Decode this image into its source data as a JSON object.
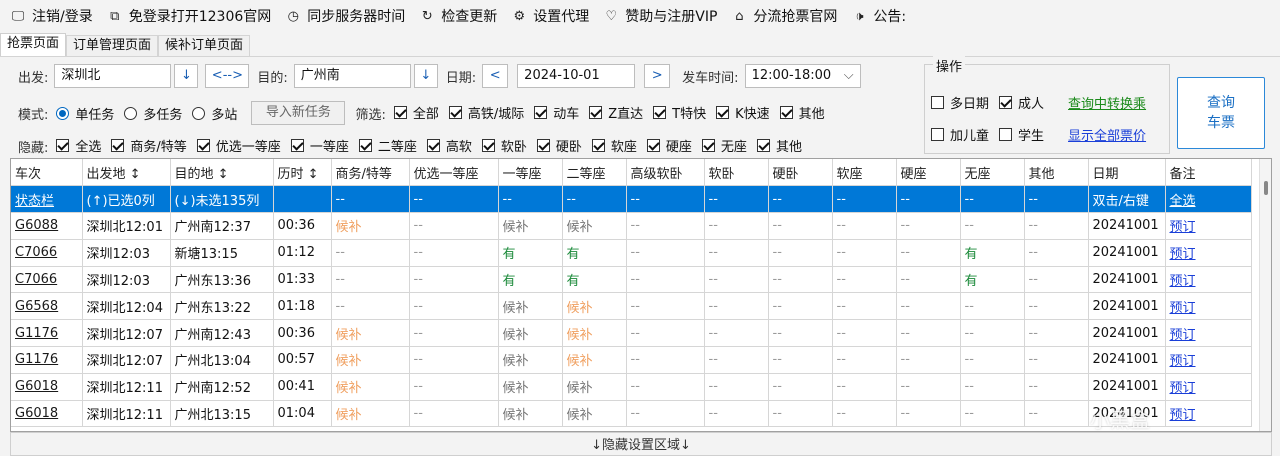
{
  "menu": [
    {
      "icon": "monitor-icon",
      "glyph": "🖵",
      "label": "注销/登录"
    },
    {
      "icon": "window-icon",
      "glyph": "⧉",
      "label": "免登录打开12306官网"
    },
    {
      "icon": "clock-icon",
      "glyph": "◷",
      "label": "同步服务器时间"
    },
    {
      "icon": "refresh-icon",
      "glyph": "↻",
      "label": "检查更新"
    },
    {
      "icon": "gear-icon",
      "glyph": "⚙",
      "label": "设置代理"
    },
    {
      "icon": "heart-icon",
      "glyph": "♡",
      "label": "赞助与注册VIP"
    },
    {
      "icon": "home-icon",
      "glyph": "⌂",
      "label": "分流抢票官网"
    },
    {
      "icon": "speaker-icon",
      "glyph": "🕩",
      "label": "公告:"
    }
  ],
  "tabs": [
    "抢票页面",
    "订单管理页面",
    "候补订单页面"
  ],
  "form": {
    "from_label": "出发:",
    "from_value": "深圳北",
    "arrow_down": "↓",
    "swap": "<-->",
    "to_label": "目的:",
    "to_value": "广州南",
    "date_label": "日期:",
    "prev": "<",
    "date_value": "2024-10-01",
    "next": ">",
    "time_label": "发车时间:",
    "time_value": "12:00-18:00",
    "dropdown": "⌵",
    "mode_label": "模式:",
    "mode_single": "单任务",
    "mode_multi": "多任务",
    "mode_station": "多站",
    "import_btn": "导入新任务",
    "filter_label": "筛选:",
    "filters": [
      "全部",
      "高铁/城际",
      "动车",
      "Z直达",
      "T特快",
      "K快速",
      "其他"
    ],
    "hide_label": "隐藏:",
    "hides": [
      "全选",
      "商务/特等",
      "优选一等座",
      "一等座",
      "二等座",
      "高软",
      "软卧",
      "硬卧",
      "软座",
      "硬座",
      "无座",
      "其他"
    ]
  },
  "ops": {
    "legend": "操作",
    "multi_date": "多日期",
    "adult": "成人",
    "child": "加儿童",
    "student": "学生",
    "transfer_link": "查询中转换乘",
    "all_price_link": "显示全部票价",
    "query_btn_line1": "查询",
    "query_btn_line2": "车票"
  },
  "table": {
    "headers": [
      "车次",
      "出发地 ↕",
      "目的地 ↕",
      "历时 ↕",
      "商务/特等",
      "优选一等座",
      "一等座",
      "二等座",
      "高级软卧",
      "软卧",
      "硬卧",
      "软座",
      "硬座",
      "无座",
      "其他",
      "日期",
      "备注"
    ],
    "status_row": [
      "状态栏",
      "(↑)已选0列",
      "(↓)未选135列",
      "",
      "--",
      "--",
      "--",
      "--",
      "--",
      "--",
      "--",
      "--",
      "--",
      "--",
      "--",
      "双击/右键",
      "全选"
    ],
    "rows": [
      [
        "G6088",
        "深圳北12:01",
        "广州南12:37",
        "00:36",
        "候补",
        "--",
        "候补",
        "候补",
        "--",
        "--",
        "--",
        "--",
        "--",
        "--",
        "--",
        "20241001",
        "预订"
      ],
      [
        "C7066",
        "深圳12:03",
        "新塘13:15",
        "01:12",
        "--",
        "--",
        "有",
        "有",
        "--",
        "--",
        "--",
        "--",
        "--",
        "有",
        "--",
        "20241001",
        "预订"
      ],
      [
        "C7066",
        "深圳12:03",
        "广州东13:36",
        "01:33",
        "--",
        "--",
        "有",
        "有",
        "--",
        "--",
        "--",
        "--",
        "--",
        "有",
        "--",
        "20241001",
        "预订"
      ],
      [
        "G6568",
        "深圳北12:04",
        "广州东13:22",
        "01:18",
        "--",
        "--",
        "候补",
        "候补",
        "--",
        "--",
        "--",
        "--",
        "--",
        "--",
        "--",
        "20241001",
        "预订"
      ],
      [
        "G1176",
        "深圳北12:07",
        "广州南12:43",
        "00:36",
        "候补",
        "--",
        "候补",
        "候补",
        "--",
        "--",
        "--",
        "--",
        "--",
        "--",
        "--",
        "20241001",
        "预订"
      ],
      [
        "G1176",
        "深圳北12:07",
        "广州北13:04",
        "00:57",
        "候补",
        "--",
        "候补",
        "候补",
        "--",
        "--",
        "--",
        "--",
        "--",
        "--",
        "--",
        "20241001",
        "预订"
      ],
      [
        "G6018",
        "深圳北12:11",
        "广州南12:52",
        "00:41",
        "候补",
        "--",
        "候补",
        "候补",
        "--",
        "--",
        "--",
        "--",
        "--",
        "--",
        "--",
        "20241001",
        "预订"
      ],
      [
        "G6018",
        "深圳北12:11",
        "广州北13:15",
        "01:04",
        "候补",
        "--",
        "候补",
        "候补",
        "--",
        "--",
        "--",
        "--",
        "--",
        "--",
        "--",
        "20241001",
        "预订"
      ]
    ],
    "row_colors": {
      "0": [
        "",
        "",
        "",
        "",
        "orange",
        "",
        "grayw",
        "grayw"
      ],
      "1": [
        "",
        "",
        "",
        "",
        "",
        "",
        "green",
        "green",
        "",
        "",
        "",
        "",
        "",
        "green"
      ],
      "2": [
        "",
        "",
        "",
        "",
        "",
        "",
        "green",
        "green",
        "",
        "",
        "",
        "",
        "",
        "green"
      ],
      "3": [
        "",
        "",
        "",
        "",
        "",
        "",
        "grayw",
        "orange"
      ],
      "4": [
        "",
        "",
        "",
        "",
        "orange",
        "",
        "grayw",
        "orange"
      ],
      "5": [
        "",
        "",
        "",
        "",
        "orange",
        "",
        "grayw",
        "orange"
      ],
      "6": [
        "",
        "",
        "",
        "",
        "orange",
        "",
        "grayw",
        "grayw"
      ],
      "7": [
        "",
        "",
        "",
        "",
        "orange",
        "",
        "grayw",
        "grayw"
      ]
    }
  },
  "bottom_bar": "↓隐藏设置区域↓",
  "watermark": "小黑盒",
  "colors": {
    "selected_row": "#0078d7",
    "orange": "#f0a060",
    "green": "#1b8a3a",
    "link": "#1a3fd8"
  }
}
